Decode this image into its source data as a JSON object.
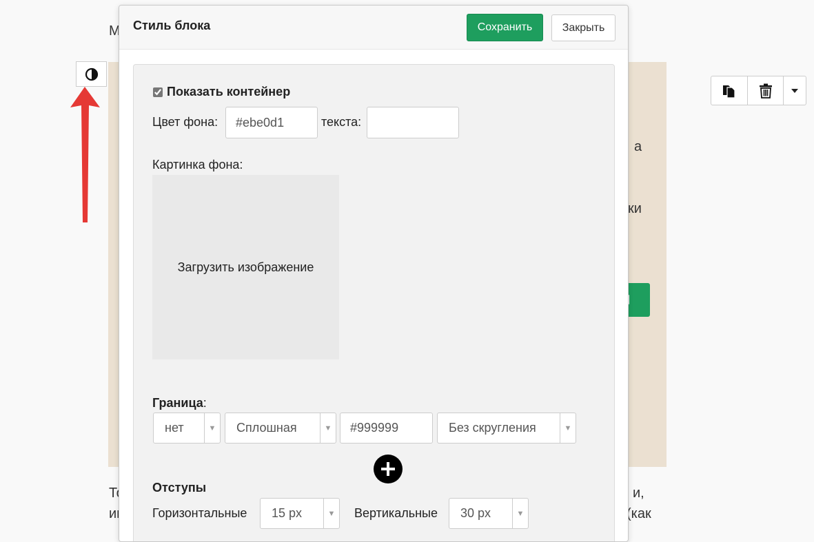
{
  "background": {
    "text_fragments": [
      "М",
      "а",
      "ки",
      "То",
      "и,",
      "ин",
      "(как"
    ],
    "block_color": "#ebe0d1",
    "accent_green": "#1e9e5e",
    "style_toggle_icon": "half-circle-contrast-icon",
    "toolbar_icons": [
      "copy-icon",
      "trash-icon",
      "caret-down-icon"
    ]
  },
  "modal": {
    "title": "Стиль блока",
    "save_label": "Сохранить",
    "close_label": "Закрыть",
    "show_container_label": "Показать контейнер",
    "show_container_checked": true,
    "bg_color_label": "Цвет фона:",
    "bg_color_value": "#ebe0d1",
    "text_color_label": "текста:",
    "text_color_value": "",
    "bg_image_label": "Картинка фона:",
    "upload_label": "Загрузить изображение",
    "border": {
      "label": "Граница",
      "suffix": ":",
      "width_value": "нет",
      "style_value": "Сплошная",
      "color_value": "#999999",
      "radius_value": "Без скругления"
    },
    "add_icon": "plus-circle-icon",
    "padding": {
      "label": "Отступы",
      "horizontal_label": "Горизонтальные",
      "horizontal_value": "15 px",
      "vertical_label": "Вертикальные",
      "vertical_value": "30 px"
    }
  }
}
